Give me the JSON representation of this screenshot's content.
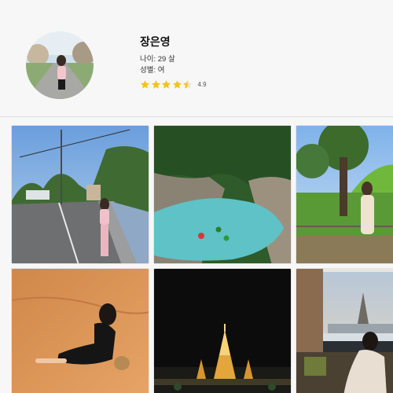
{
  "profile": {
    "name": "장은영",
    "age": "나이: 29 살",
    "gender": "성별: 여",
    "rating": {
      "value": "4.9",
      "stars": 4.9,
      "max": 5,
      "color": "#f4c21b"
    }
  },
  "photos": [
    {
      "icon": "street-photo-icon"
    },
    {
      "icon": "river-photo-icon"
    },
    {
      "icon": "park-photo-icon"
    },
    {
      "icon": "desert-photo-icon"
    },
    {
      "icon": "temple-night-photo-icon"
    },
    {
      "icon": "hotel-view-photo-icon"
    }
  ]
}
